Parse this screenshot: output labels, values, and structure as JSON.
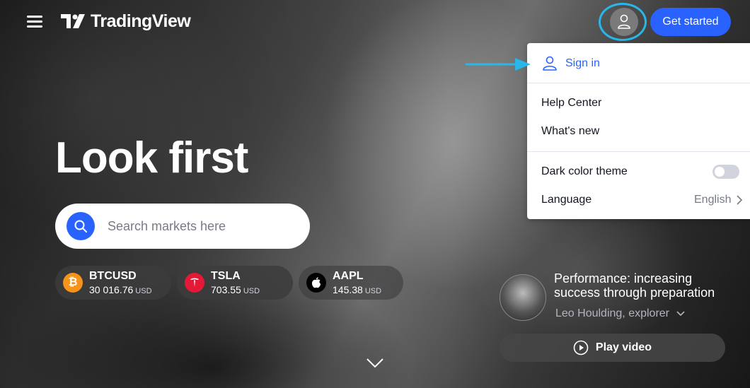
{
  "header": {
    "logo_text": "TradingView",
    "get_started_label": "Get started"
  },
  "dropdown": {
    "sign_in_label": "Sign in",
    "help_center_label": "Help Center",
    "whats_new_label": "What's new",
    "dark_theme_label": "Dark color theme",
    "dark_theme_enabled": false,
    "language_label": "Language",
    "language_value": "English"
  },
  "hero": {
    "headline": "Look first",
    "search_placeholder": "Search markets here"
  },
  "tickers": [
    {
      "symbol": "BTCUSD",
      "price": "30 016.76",
      "currency": "USD",
      "icon": "bitcoin-icon",
      "color": "#f7931a"
    },
    {
      "symbol": "TSLA",
      "price": "703.55",
      "currency": "USD",
      "icon": "tesla-icon",
      "color": "#e31937"
    },
    {
      "symbol": "AAPL",
      "price": "145.38",
      "currency": "USD",
      "icon": "apple-icon",
      "color": "#000000"
    }
  ],
  "video": {
    "title": "Performance: increasing success through preparation",
    "author": "Leo Houlding, explorer",
    "play_label": "Play video"
  },
  "colors": {
    "accent": "#2962ff",
    "highlight_ring": "#29b6e8"
  }
}
